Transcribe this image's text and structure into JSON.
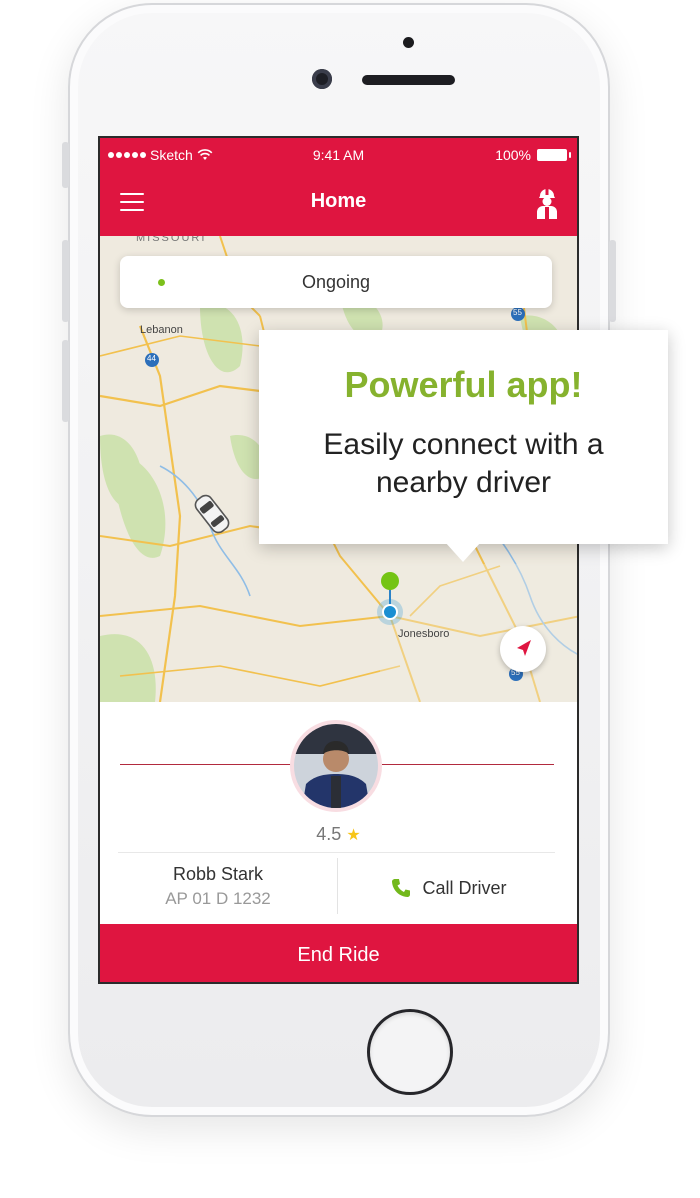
{
  "status_bar": {
    "carrier": "Sketch",
    "time": "9:41 AM",
    "battery": "100%"
  },
  "nav": {
    "title": "Home"
  },
  "map": {
    "status_pill": "Ongoing",
    "labels": {
      "lebanon": "Lebanon",
      "jonesboro": "Jonesboro",
      "missouri": "MISSOURI",
      "hwy44": "44",
      "hwy55a": "55",
      "hwy55b": "55"
    }
  },
  "driver": {
    "rating": "4.5",
    "name": "Robb Stark",
    "plate": "AP 01 D 1232",
    "call_label": "Call Driver"
  },
  "actions": {
    "end_ride": "End Ride"
  },
  "callout": {
    "title": "Powerful app!",
    "body": "Easily connect with a nearby driver"
  },
  "colors": {
    "brand_red": "#df1540",
    "accent_green": "#86b22e",
    "status_green": "#7cc01b",
    "route_blue": "#1b8fd2",
    "star_yellow": "#f7c518"
  }
}
